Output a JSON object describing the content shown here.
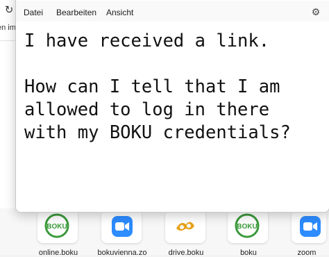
{
  "background_browser": {
    "tab_label_fragment": "en im"
  },
  "shortcuts": [
    {
      "label": "online.boku",
      "icon": "boku-logo-icon"
    },
    {
      "label": "bokuvienna.zo",
      "icon": "zoom-icon"
    },
    {
      "label": "drive.boku",
      "icon": "drive-boku-icon"
    },
    {
      "label": "boku",
      "icon": "boku-logo-icon"
    },
    {
      "label": "zoom",
      "icon": "zoom-icon"
    }
  ],
  "notepad": {
    "menu": {
      "file": "Datei",
      "edit": "Bearbeiten",
      "view": "Ansicht"
    },
    "settings_icon": "gear-icon",
    "content": "I have received a link.\n\nHow can I tell that I am\nallowed to log in there\nwith my BOKU credentials?"
  },
  "colors": {
    "zoom_blue": "#2d8cff",
    "boku_green": "#3a9a3a",
    "drive_orange": "#e8a21a"
  }
}
